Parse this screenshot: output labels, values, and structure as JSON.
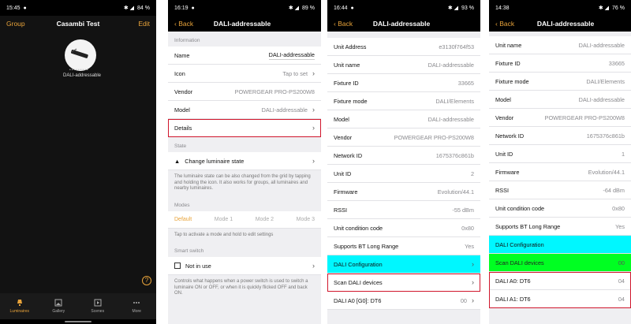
{
  "phone1": {
    "status": {
      "time": "15:45",
      "battery": "84 %"
    },
    "nav": {
      "left": "Group",
      "title": "Casambi Test",
      "right": "Edit"
    },
    "luminaire_label": "DALI-addressable",
    "help": "?",
    "tabs": [
      "Luminaires",
      "Gallery",
      "Scenes",
      "More"
    ]
  },
  "phone2": {
    "status": {
      "time": "16:19",
      "battery": "89 %"
    },
    "nav": {
      "back": "Back",
      "title": "DALI-addressable"
    },
    "information_header": "Information",
    "info_rows": [
      {
        "label": "Name",
        "value": "DALI-addressable"
      },
      {
        "label": "Icon",
        "value": "Tap to set"
      },
      {
        "label": "Vendor",
        "value": "POWERGEAR PRO-PS200W8"
      },
      {
        "label": "Model",
        "value": "DALI-addressable"
      },
      {
        "label": "Details",
        "value": ""
      }
    ],
    "state_header": "State",
    "state_row": "Change luminaire state",
    "state_note": "The luminaire state can be also changed from the grid by tapping and holding the icon. It also works for groups, all luminaires and nearby luminaires.",
    "modes_header": "Modes",
    "modes": [
      "Default",
      "Mode 1",
      "Mode 2",
      "Mode 3"
    ],
    "modes_note": "Tap to activate a mode and hold to edit settings",
    "smart_header": "Smart switch",
    "smart_row": "Not in use",
    "smart_note": "Controls what happens when a power switch is used to switch a luminaire ON or OFF, or when it is quickly flicked OFF and back ON."
  },
  "phone3": {
    "status": {
      "time": "16:44",
      "battery": "93 %"
    },
    "nav": {
      "back": "Back",
      "title": "DALI-addressable"
    },
    "rows": [
      {
        "label": "Unit Address",
        "value": "e3130f764f53"
      },
      {
        "label": "Unit name",
        "value": "DALI-addressable"
      },
      {
        "label": "Fixture ID",
        "value": "33665"
      },
      {
        "label": "Fixture mode",
        "value": "DALI/Elements"
      },
      {
        "label": "Model",
        "value": "DALI-addressable"
      },
      {
        "label": "Vendor",
        "value": "POWERGEAR PRO-PS200W8"
      },
      {
        "label": "Network ID",
        "value": "1675376c861b"
      },
      {
        "label": "Unit ID",
        "value": "2"
      },
      {
        "label": "Firmware",
        "value": "Evolution/44.1"
      },
      {
        "label": "RSSI",
        "value": "-55 dBm"
      },
      {
        "label": "Unit condition code",
        "value": "0x80"
      },
      {
        "label": "Supports BT Long Range",
        "value": "Yes"
      }
    ],
    "dali_config": "DALI Configuration",
    "scan_dali": "Scan DALI devices",
    "dali_a0": {
      "label": "DALI A0 [G0]: DT6",
      "value": "00"
    }
  },
  "phone4": {
    "status": {
      "time": "14:38",
      "battery": "76 %"
    },
    "nav": {
      "back": "Back",
      "title": "DALI-addressable"
    },
    "rows": [
      {
        "label": "Unit name",
        "value": "DALI-addressable"
      },
      {
        "label": "Fixture ID",
        "value": "33665"
      },
      {
        "label": "Fixture mode",
        "value": "DALI/Elements"
      },
      {
        "label": "Model",
        "value": "DALI-addressable"
      },
      {
        "label": "Vendor",
        "value": "POWERGEAR PRO-PS200W8"
      },
      {
        "label": "Network ID",
        "value": "1675376c861b"
      },
      {
        "label": "Unit ID",
        "value": "1"
      },
      {
        "label": "Firmware",
        "value": "Evolution/44.1"
      },
      {
        "label": "RSSI",
        "value": "-64 dBm"
      },
      {
        "label": "Unit condition code",
        "value": "0x80"
      },
      {
        "label": "Supports BT Long Range",
        "value": "Yes"
      }
    ],
    "dali_config": "DALI Configuration",
    "scan_dali": "Scan DALI devices",
    "scan_value": "00",
    "devices": [
      {
        "label": "DALI A0: DT6",
        "value": "04"
      },
      {
        "label": "DALI A1: DT6",
        "value": "04"
      }
    ]
  },
  "colors": {
    "accent": "#e8a33a",
    "highlight": "#d0162c",
    "cyan": "#00f7ff",
    "green": "#00ff22"
  }
}
